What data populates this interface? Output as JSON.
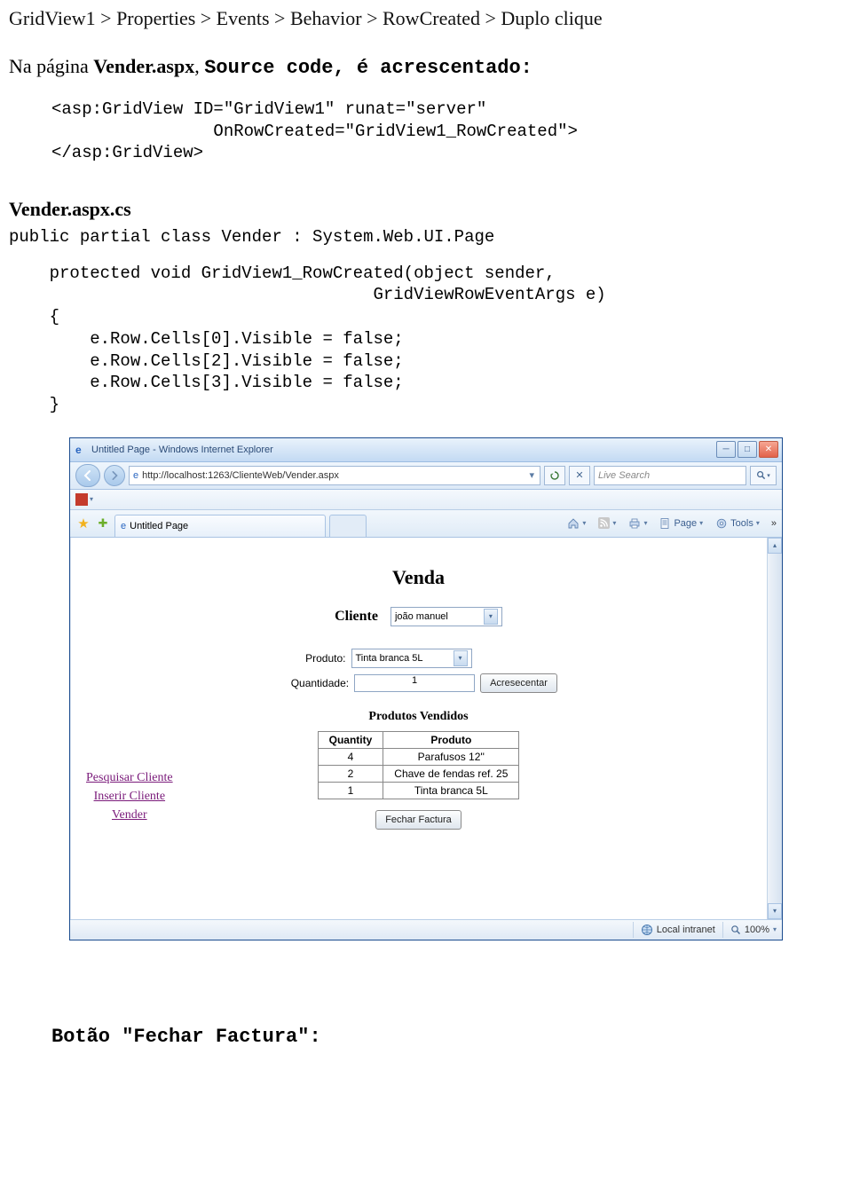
{
  "breadcrumb": "GridView1  > Properties  > Events  > Behavior  >  RowCreated  >  Duplo clique",
  "intro_prefix": "Na página ",
  "intro_bold": "Vender.aspx",
  "intro_suffix": ", ",
  "intro_code": "Source code, é acrescentado:",
  "code_block_1": "<asp:GridView ID=\"GridView1\" runat=\"server\"\n                OnRowCreated=\"GridView1_RowCreated\">\n</asp:GridView>",
  "heading_cs": "Vender.aspx.cs",
  "code_block_2": "public partial class Vender : System.Web.UI.Page",
  "code_block_3": "    protected void GridView1_RowCreated(object sender,\n                                    GridViewRowEventArgs e)\n    {\n        e.Row.Cells[0].Visible = false;\n        e.Row.Cells[2].Visible = false;\n        e.Row.Cells[3].Visible = false;\n    }",
  "ie": {
    "title": "Untitled Page - Windows Internet Explorer",
    "url": "http://localhost:1263/ClienteWeb/Vender.aspx",
    "search_placeholder": "Live Search",
    "tab_label": "Untitled Page",
    "page_menu": "Page",
    "tools_menu": "Tools",
    "status_zone": "Local intranet",
    "status_zoom": "100%"
  },
  "venda": {
    "title": "Venda",
    "cliente_label": "Cliente",
    "cliente_value": "joão manuel",
    "produto_label": "Produto:",
    "produto_value": "Tinta branca 5L",
    "quantidade_label": "Quantidade:",
    "quantidade_value": "1",
    "add_button": "Acresecentar",
    "pv_title": "Produtos Vendidos",
    "grid_headers": {
      "qty": "Quantity",
      "prod": "Produto"
    },
    "rows": [
      {
        "qty": "4",
        "prod": "Parafusos 12''"
      },
      {
        "qty": "2",
        "prod": "Chave de fendas ref. 25"
      },
      {
        "qty": "1",
        "prod": "Tinta branca 5L"
      }
    ],
    "fechar_btn": "Fechar Factura",
    "links": {
      "pesquisar": "Pesquisar Cliente",
      "inserir": "Inserir Cliente",
      "vender": "Vender"
    }
  },
  "footer_heading": "Botão \"Fechar Factura\":"
}
